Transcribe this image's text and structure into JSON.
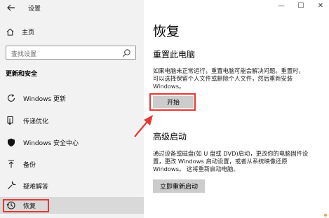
{
  "window": {
    "title": "设置",
    "controls": {
      "minimize": "—",
      "maximize": "☐",
      "close": "✕"
    }
  },
  "sidebar": {
    "home_label": "主页",
    "search_placeholder": "查找设置",
    "section_title": "更新和安全",
    "items": [
      {
        "label": "Windows 更新",
        "icon": "refresh-icon"
      },
      {
        "label": "传递优化",
        "icon": "delivery-optimization-icon"
      },
      {
        "label": "Windows 安全中心",
        "icon": "shield-icon"
      },
      {
        "label": "备份",
        "icon": "backup-arrow-icon"
      },
      {
        "label": "疑难解答",
        "icon": "wrench-icon"
      },
      {
        "label": "恢复",
        "icon": "history-icon",
        "active": true
      }
    ]
  },
  "main": {
    "title": "恢复",
    "reset": {
      "heading": "重置此电脑",
      "description_lines": [
        "如果电脑未正常运行，重置电脑可能会解决问题。重置时，",
        "可以选择保留个人文件或删除个人文件，然后重新安装",
        "Windows。"
      ],
      "button_label": "开始"
    },
    "advanced": {
      "heading": "高级启动",
      "description_lines": [
        "通过设备或磁盘(如 U 盘或 DVD)启动，更改你的电脑固件设",
        "置，更改 Windows 启动设置，或者从系统映像还原",
        "Windows。 这将重新启动电脑。"
      ],
      "button_label": "立即重新启动"
    }
  },
  "colors": {
    "highlight_red": "#e53935",
    "sidebar_bg": "#f2f2f2",
    "button_bg": "#cccccc"
  }
}
